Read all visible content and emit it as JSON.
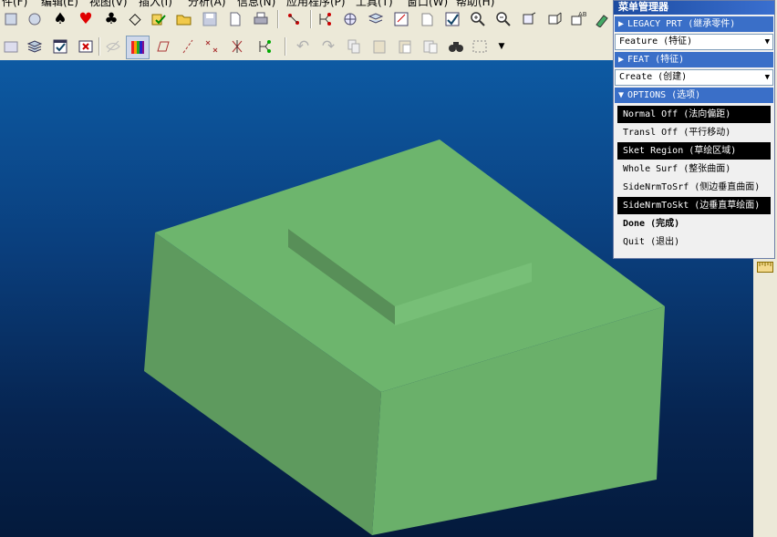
{
  "menubar": {
    "items": [
      "件(F)",
      "编辑(E)",
      "视图(V)",
      "插入(I)",
      "分析(A)",
      "信息(N)",
      "应用程序(P)",
      "工具(T)",
      "窗口(W)",
      "帮助(H)"
    ]
  },
  "toolbar": {
    "row1": [
      "new-part-icon",
      "open-part-icon",
      "spade-icon",
      "heart-icon",
      "club-icon",
      "diamond-icon",
      "checklist-icon",
      "open-folder-icon",
      "save-icon",
      "new-file-icon",
      "print-icon",
      "datum-point-icon",
      "regenerate-icon",
      "model-tree-icon",
      "sketch-icon",
      "zoom-in-icon",
      "zoom-out-icon",
      "refit-icon",
      "annotation-icon",
      "eraser-icon"
    ],
    "row2": [
      "layer-icon",
      "layers-icon",
      "checkbox-icon",
      "close-box-icon",
      "hidden-eye-icon",
      "shade-icon",
      "datum-plane-icon",
      "datum-axis-icon",
      "datum-point-x-icon",
      "datum-csys-icon",
      "datum-curve-icon",
      "undo-icon",
      "redo-icon",
      "copy-icon",
      "paste-icon",
      "paste-special-icon",
      "layer-select-icon",
      "find-icon",
      "selection-box-icon",
      "dropdown-icon"
    ]
  },
  "colors": {
    "bg_top": "#0d5aa3",
    "bg_bottom": "#041a3c",
    "model_top": "#6db56d",
    "model_left": "#5e9a5e",
    "model_front": "#6ab06a",
    "highlight": "#000000",
    "menu_title": "#1c4ba0"
  },
  "menu_manager": {
    "title": "菜单管理器",
    "legacy": "LEGACY PRT (继承零件)",
    "feature_combo": "Feature (特征)",
    "feat": "FEAT (特征)",
    "create_combo": "Create (创建)",
    "options": "OPTIONS (选项)",
    "items": [
      {
        "label": "Normal Off (法向偏距)",
        "selected": true
      },
      {
        "label": "Transl Off (平行移动)",
        "selected": false
      },
      {
        "label": "Sket Region (草绘区域)",
        "selected": true
      },
      {
        "label": "Whole Surf (整张曲面)",
        "selected": false
      },
      {
        "label": "SideNrmToSrf (侧边垂直曲面)",
        "selected": false
      },
      {
        "label": "SideNrmToSkt (边垂直草绘面)",
        "selected": true
      }
    ],
    "done": "Done (完成)",
    "quit": "Quit (退出)"
  }
}
